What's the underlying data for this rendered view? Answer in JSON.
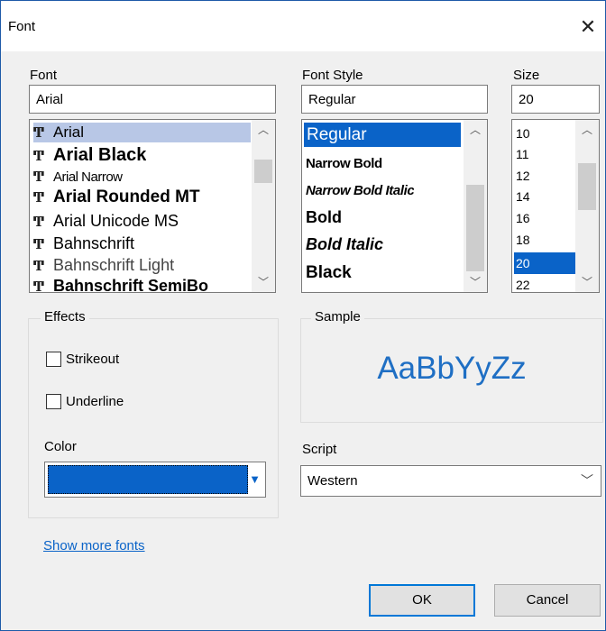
{
  "window": {
    "title": "Font",
    "close_glyph": "✕"
  },
  "font": {
    "label": "Font",
    "value": "Arial",
    "items": [
      "Arial",
      "Arial Black",
      "Arial Narrow",
      "Arial Rounded MT",
      "Arial Unicode MS",
      "Bahnschrift",
      "Bahnschrift Light",
      "Bahnschrift SemiBo"
    ],
    "selected": "Arial"
  },
  "style": {
    "label": "Font Style",
    "value": "Regular",
    "items": [
      "Regular",
      "Narrow Bold",
      "Narrow Bold Italic",
      "Bold",
      "Bold Italic",
      "Black"
    ],
    "selected": "Regular"
  },
  "size": {
    "label": "Size",
    "value": "20",
    "items": [
      "10",
      "11",
      "12",
      "14",
      "16",
      "18",
      "20",
      "22"
    ],
    "selected": "20"
  },
  "effects": {
    "label": "Effects",
    "strikeout": "Strikeout",
    "underline": "Underline",
    "color_label": "Color",
    "color_value": "#0a63c8"
  },
  "sample": {
    "label": "Sample",
    "text": "AaBbYyZz",
    "color": "#1f6fc4"
  },
  "script": {
    "label": "Script",
    "value": "Western"
  },
  "links": {
    "more_fonts": "Show more fonts"
  },
  "buttons": {
    "ok": "OK",
    "cancel": "Cancel"
  },
  "icons": {
    "truetype": "truetype-icon",
    "close": "close-icon",
    "scroll_up": "scroll-up-arrow-icon",
    "scroll_down": "scroll-down-arrow-icon",
    "dropdown": "chevron-down-icon"
  }
}
